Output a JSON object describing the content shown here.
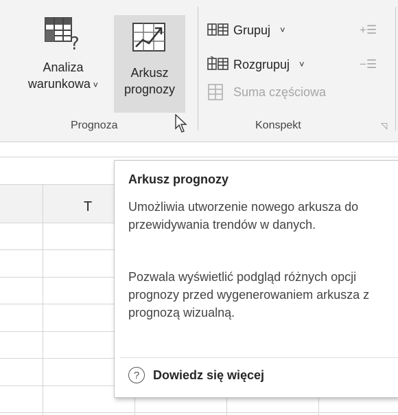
{
  "ribbon": {
    "prognoza": {
      "analiza_label": "Analiza\nwarunkowa ˅",
      "analiza_line1": "Analiza",
      "analiza_line2": "warunkowa",
      "arkusz_line1": "Arkusz",
      "arkusz_line2": "prognozy",
      "group_label": "Prognoza"
    },
    "konspekt": {
      "grupuj": "Grupuj",
      "rozgrupuj": "Rozgrupuj",
      "suma": "Suma częściowa",
      "group_label": "Konspekt"
    }
  },
  "sheet": {
    "column_letter": "T"
  },
  "tooltip": {
    "title": "Arkusz prognozy",
    "para1": "Umożliwia utworzenie nowego arkusza do przewidywania trendów w danych.",
    "para2": "Pozwala wyświetlić podgląd różnych opcji prognozy przed wygenerowaniem arkusza z prognozą wizualną.",
    "help_link": "Dowiedz się więcej"
  },
  "colors": {
    "ribbon_bg": "#f3f3f3",
    "hover_bg": "#dcdcdc",
    "disabled_text": "#a6a6a6"
  }
}
